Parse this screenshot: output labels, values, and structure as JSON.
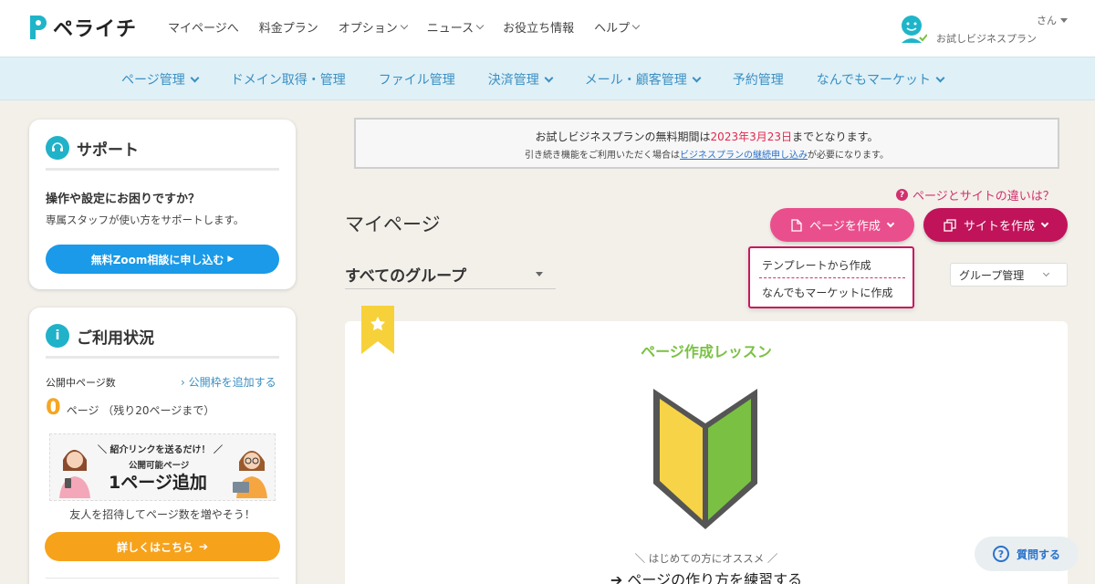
{
  "header": {
    "logo_text": "ペライチ",
    "nav": [
      "マイページへ",
      "料金プラン",
      "オプション",
      "ニュース",
      "お役立ち情報",
      "ヘルプ"
    ],
    "user_name": "さん",
    "user_plan": "お試しビジネスプラン"
  },
  "subnav": {
    "items": [
      "ページ管理",
      "ドメイン取得・管理",
      "ファイル管理",
      "決済管理",
      "メール・顧客管理",
      "予約管理",
      "なんでもマーケット"
    ]
  },
  "support": {
    "title": "サポート",
    "question": "操作や設定にお困りですか？",
    "desc": "専属スタッフが使い方をサポートします。",
    "button": "無料Zoom相談に申し込む"
  },
  "usage": {
    "title": "ご利用状況",
    "published_label": "公開中ページ数",
    "add_link": "公開枠を追加する",
    "count": "0",
    "count_unit": "ページ （残り20ページまで）",
    "promo_line1": "紹介リンクを送るだけ！",
    "promo_line2": "公開可能ページ",
    "promo_line3": "1ページ追加",
    "invite": "友人を招待してページ数を増やそう！",
    "detail_button": "詳しくはこちら"
  },
  "notice": {
    "line1_prefix": "お試しビジネスプランの無料期間は",
    "line1_date": "2023年3月23日",
    "line1_suffix": "までとなります。",
    "line2_prefix": "引き続き機能をご利用いただく場合は",
    "line2_link": "ビジネスプランの継続申し込み",
    "line2_suffix": "が必要になります。"
  },
  "main": {
    "diff_link": "ページとサイトの違いは？",
    "title": "マイページ",
    "create_page": "ページを作成",
    "create_site": "サイトを作成",
    "dropdown": [
      "テンプレートから作成",
      "なんでもマーケットに作成"
    ],
    "group_select": "すべてのグループ",
    "group_mgmt": "グループ管理"
  },
  "lesson": {
    "title": "ページ作成レッスン",
    "sub": "＼ はじめての方にオススメ ／",
    "cta": "ページの作り方を練習する"
  },
  "help": {
    "label": "質問する"
  },
  "colors": {
    "brand_blue": "#1a9ae8",
    "brand_pink": "#ea4f8d",
    "brand_magenta": "#c0135a",
    "lesson_green": "#7ac143",
    "accent_orange": "#f7a21b"
  }
}
